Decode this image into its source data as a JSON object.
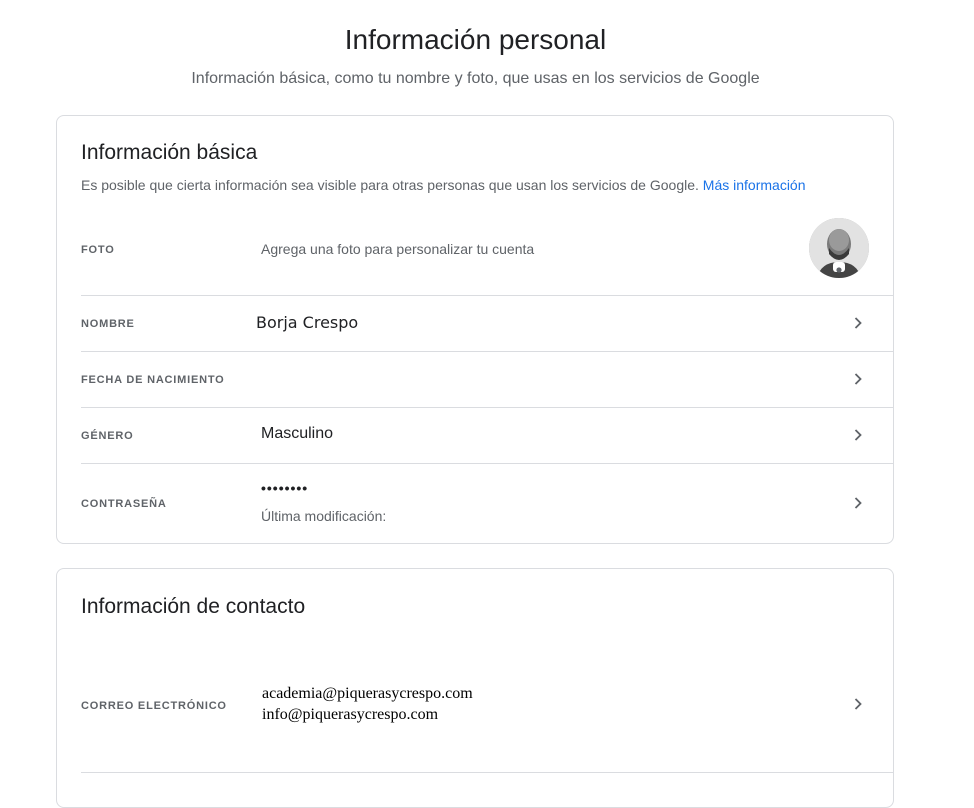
{
  "header": {
    "title": "Información personal",
    "subtitle": "Información básica, como tu nombre y foto, que usas en los servicios de Google"
  },
  "basic_info": {
    "title": "Información básica",
    "description": "Es posible que cierta información sea visible para otras personas que usan los servicios de Google.",
    "more_info_link": "Más información",
    "rows": {
      "photo": {
        "label": "FOTO",
        "value": "Agrega una foto para personalizar tu cuenta"
      },
      "name": {
        "label": "NOMBRE",
        "value": "Borja Crespo"
      },
      "birthdate": {
        "label": "FECHA DE NACIMIENTO",
        "value": ""
      },
      "gender": {
        "label": "GÉNERO",
        "value": "Masculino"
      },
      "password": {
        "label": "CONTRASEÑA",
        "value": "••••••••",
        "last_modified": "Última modificación:"
      }
    }
  },
  "contact_info": {
    "title": "Información de contacto",
    "rows": {
      "email": {
        "label": "CORREO ELECTRÓNICO",
        "values": [
          "academia@piquerasycrespo.com",
          "info@piquerasycrespo.com"
        ]
      }
    }
  },
  "icons": {
    "chevron": "chevron-right-icon",
    "avatar": "profile-photo",
    "camera": "camera-icon"
  },
  "colors": {
    "link": "#1a73e8",
    "border": "#dadce0",
    "text_primary": "#202124",
    "text_secondary": "#5f6368"
  }
}
